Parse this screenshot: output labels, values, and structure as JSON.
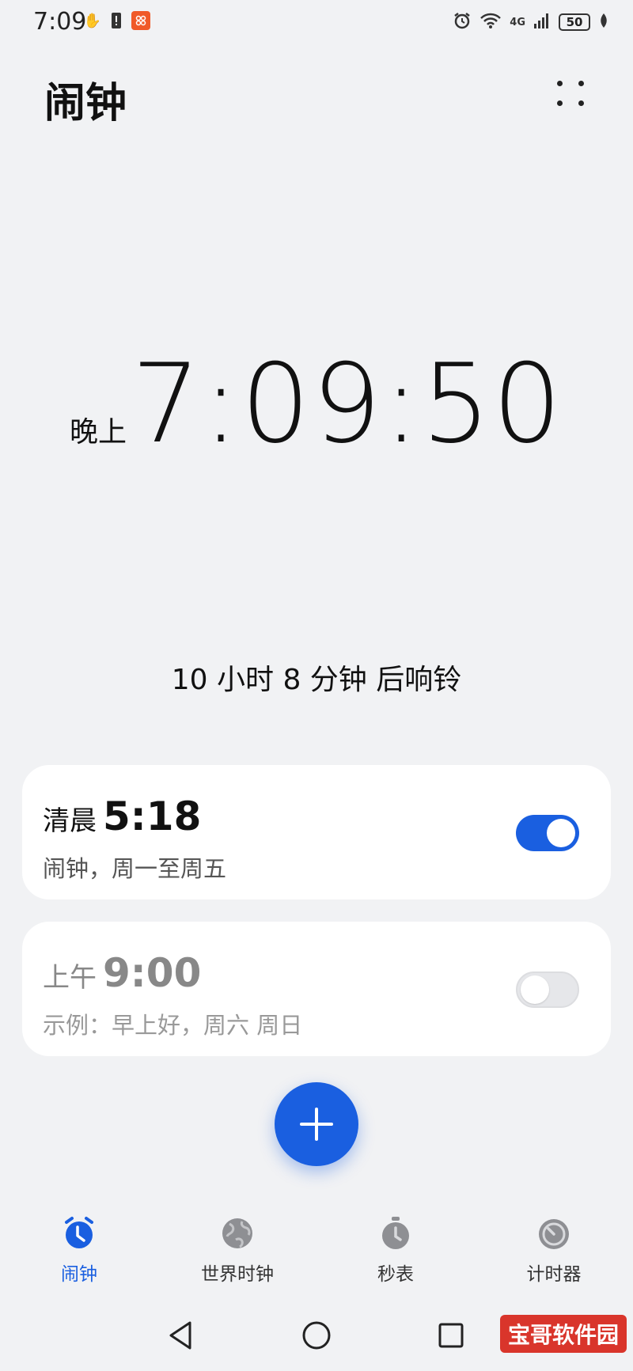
{
  "status_bar": {
    "time": "7:09",
    "network": "4G",
    "battery": "50"
  },
  "header": {
    "title": "闹钟"
  },
  "clock": {
    "period": "晚上",
    "time": "7:09:50"
  },
  "next_ring": "10 小时 8 分钟 后响铃",
  "alarms": [
    {
      "period": "清晨",
      "time": "5:18",
      "label": "闹钟，周一至周五",
      "enabled": true
    },
    {
      "period": "上午",
      "time": "9:00",
      "label": "示例：早上好，周六 周日",
      "enabled": false
    }
  ],
  "tabs": [
    {
      "label": "闹钟",
      "icon": "alarm-clock-icon",
      "active": true
    },
    {
      "label": "世界时钟",
      "icon": "globe-icon",
      "active": false
    },
    {
      "label": "秒表",
      "icon": "stopwatch-icon",
      "active": false
    },
    {
      "label": "计时器",
      "icon": "timer-icon",
      "active": false
    }
  ],
  "watermark": "宝哥软件园",
  "colors": {
    "accent": "#1a5fe0",
    "background": "#f1f2f4"
  }
}
